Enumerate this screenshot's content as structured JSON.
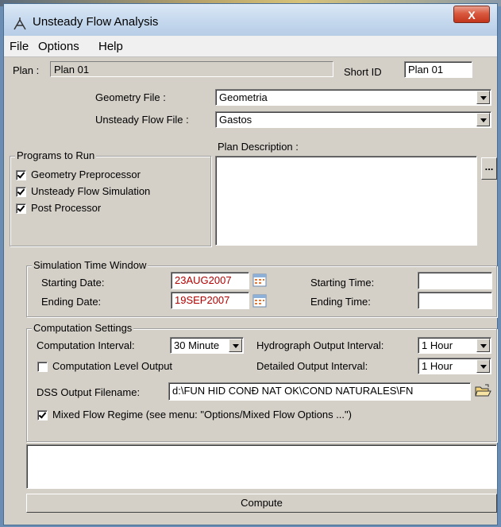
{
  "window": {
    "title": "Unsteady Flow Analysis",
    "close_label": "X"
  },
  "menu": [
    "File",
    "Options",
    "Help"
  ],
  "plan": {
    "label": "Plan :",
    "value": "Plan 01",
    "short_id_label": "Short ID",
    "short_id_value": "Plan 01"
  },
  "geometry": {
    "label": "Geometry File :",
    "value": "Geometria"
  },
  "unsteady": {
    "label": "Unsteady Flow File :",
    "value": "Gastos"
  },
  "description": {
    "label": "Plan Description :",
    "value": "",
    "browse_label": "..."
  },
  "programs": {
    "title": "Programs to Run",
    "items": [
      {
        "label": "Geometry Preprocessor",
        "checked": true
      },
      {
        "label": "Unsteady Flow Simulation",
        "checked": true
      },
      {
        "label": "Post Processor",
        "checked": true
      }
    ]
  },
  "time_window": {
    "title": "Simulation Time Window",
    "starting_date_label": "Starting Date:",
    "starting_date": "23AUG2007",
    "starting_time_label": "Starting Time:",
    "starting_time": "",
    "ending_date_label": "Ending Date:",
    "ending_date": "19SEP2007",
    "ending_time_label": "Ending Time:",
    "ending_time": ""
  },
  "computation": {
    "title": "Computation Settings",
    "interval_label": "Computation Interval:",
    "interval_value": "30 Minute",
    "hydrograph_label": "Hydrograph Output Interval:",
    "hydrograph_value": "1 Hour",
    "level_output_label": "Computation Level Output",
    "level_output_checked": false,
    "detailed_label": "Detailed Output Interval:",
    "detailed_value": "1 Hour",
    "dss_label": "DSS Output Filename:",
    "dss_value": "d:\\FUN HID CONĐ NAT OK\\COND NATURALES\\FN",
    "mixed_label": "Mixed Flow Regime (see menu: \"Options/Mixed Flow Options ...\")",
    "mixed_checked": true
  },
  "messages": "",
  "compute_label": "Compute"
}
